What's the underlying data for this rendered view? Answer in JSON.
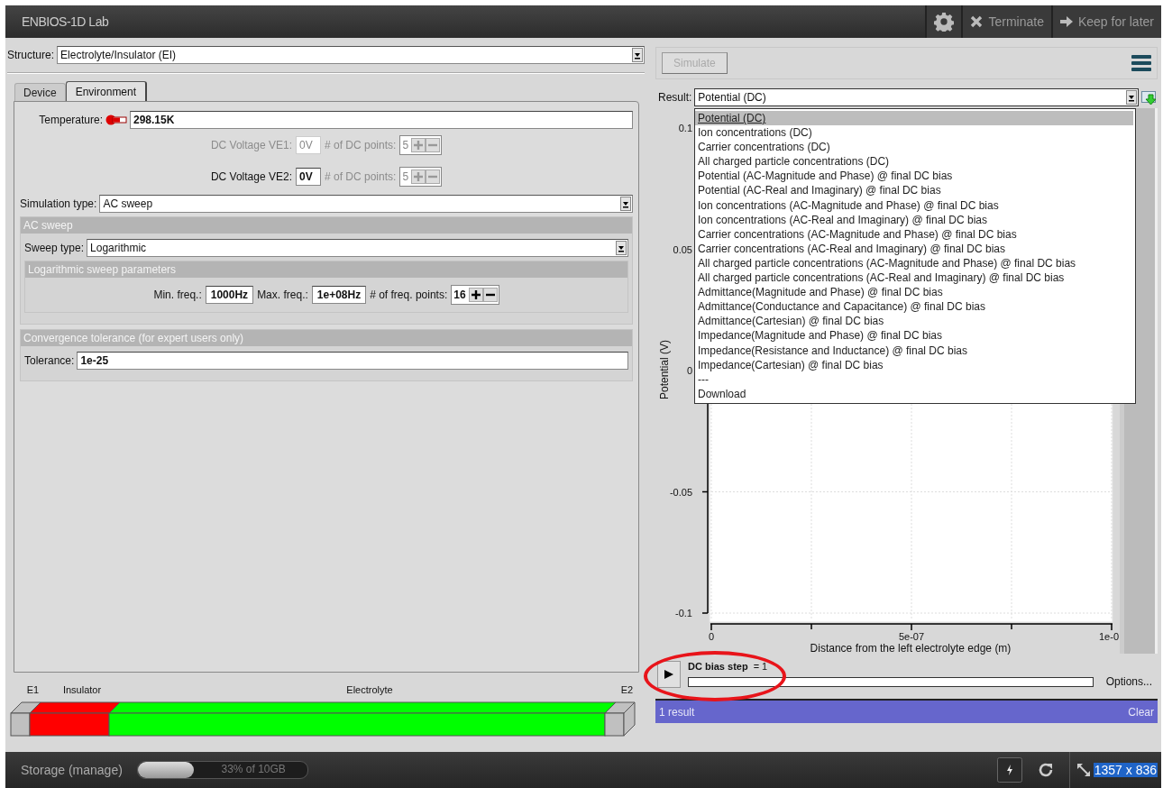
{
  "window": {
    "title": "ENBIOS-1D Lab"
  },
  "header_actions": [
    {
      "kind": "settings"
    },
    {
      "kind": "terminate",
      "label": "Terminate"
    },
    {
      "kind": "keep",
      "label": "Keep for later"
    }
  ],
  "structure": {
    "label": "Structure:",
    "value": "Electrolyte/Insulator (EI)"
  },
  "tabs": [
    {
      "label": "Device",
      "selected": false
    },
    {
      "label": "Environment",
      "selected": true
    }
  ],
  "temperature": {
    "label": "Temperature:",
    "value": "298.15K"
  },
  "dc_voltages": [
    {
      "label": "DC Voltage VE1:",
      "value": "0V",
      "disabled": true,
      "points_label": "# of DC points:",
      "points": "5",
      "points_disabled": true
    },
    {
      "label": "DC Voltage VE2:",
      "value": "0V",
      "disabled": false,
      "points_label": "# of DC points:",
      "points": "5",
      "points_disabled": true
    }
  ],
  "simulation_type": {
    "label": "Simulation type:",
    "value": "AC sweep"
  },
  "ac_sweep": {
    "title": "AC sweep",
    "sweep_type": {
      "label": "Sweep type:",
      "value": "Logarithmic"
    },
    "parameters": {
      "title": "Logarithmic sweep parameters",
      "fields": [
        {
          "label": "Min. freq.:",
          "value": "1000Hz"
        },
        {
          "label": "Max. freq.:",
          "value": "1e+08Hz"
        }
      ],
      "points": {
        "label": "# of freq. points:",
        "value": "16",
        "disabled": false
      }
    }
  },
  "convergence": {
    "title": "Convergence tolerance (for expert users only)",
    "field": {
      "label": "Tolerance:",
      "value": "1e-25"
    }
  },
  "device": {
    "layers": [
      {
        "kind": "electrode",
        "label": "E1",
        "color": "#c0c0c0"
      },
      {
        "kind": "insulator",
        "label": "Insulator",
        "color": "#ff0000"
      },
      {
        "kind": "electrolyte",
        "label": "Electrolyte",
        "color": "#00ff00"
      },
      {
        "kind": "electrode",
        "label": "E2",
        "color": "#c0c0c0"
      }
    ]
  },
  "toolbar": {
    "simulate": {
      "label": "Simulate",
      "disabled": true
    }
  },
  "result": {
    "label": "Result:",
    "value": "Potential (DC)",
    "open": true,
    "options": [
      {
        "label": "Potential (DC)",
        "selected": true
      },
      {
        "label": "Ion concentrations (DC)",
        "selected": false
      },
      {
        "label": "Carrier concentrations (DC)",
        "selected": false
      },
      {
        "label": "All charged particle concentrations (DC)",
        "selected": false
      },
      {
        "label": "Potential (AC-Magnitude and Phase) @ final DC bias",
        "selected": false
      },
      {
        "label": "Potential (AC-Real and Imaginary) @ final DC bias",
        "selected": false
      },
      {
        "label": "Ion concentrations (AC-Magnitude and Phase) @ final DC bias",
        "selected": false
      },
      {
        "label": "Ion concentrations (AC-Real and Imaginary) @ final DC bias",
        "selected": false
      },
      {
        "label": "Carrier concentrations (AC-Magnitude and Phase) @ final DC bias",
        "selected": false
      },
      {
        "label": "Carrier concentrations (AC-Real and Imaginary) @ final DC bias",
        "selected": false
      },
      {
        "label": "All charged particle concentrations (AC-Magnitude and Phase) @ final DC bias",
        "selected": false
      },
      {
        "label": "All charged particle concentrations (AC-Real and Imaginary) @ final DC bias",
        "selected": false
      },
      {
        "label": "Admittance(Magnitude and Phase) @ final DC bias",
        "selected": false
      },
      {
        "label": "Admittance(Conductance and Capacitance) @ final DC bias",
        "selected": false
      },
      {
        "label": "Admittance(Cartesian) @ final DC bias",
        "selected": false
      },
      {
        "label": "Impedance(Magnitude and Phase) @ final DC bias",
        "selected": false
      },
      {
        "label": "Impedance(Resistance and Inductance) @ final DC bias",
        "selected": false
      },
      {
        "label": "Impedance(Cartesian) @ final DC bias",
        "selected": false
      },
      {
        "label": "---",
        "selected": false
      },
      {
        "label": "Download",
        "selected": false
      }
    ]
  },
  "chart": {
    "chart_data": {
      "type": "line",
      "xlabel": "Distance from the left electrolyte edge (m)",
      "ylabel": "Potential (V)",
      "xlim": [
        0,
        1e-06
      ],
      "ylim": [
        -0.1,
        0.1
      ],
      "xticks": [
        {
          "value": 0,
          "label": "0"
        },
        {
          "value": 5e-07,
          "label": "5e-07"
        },
        {
          "label": "1e-0"
        }
      ],
      "yticks": [
        0.1,
        0.05,
        0,
        -0.05,
        -0.1
      ]
    }
  },
  "playback": {
    "label": "DC bias step",
    "value": "= 1",
    "level": 0,
    "options_label": "Options..."
  },
  "results_bar": {
    "count": "1 result",
    "clear": "Clear"
  },
  "status_bar": {
    "storage_label": "Storage (manage)",
    "storage": {
      "level": 0.33,
      "text": "33% of 10GB"
    },
    "screen_size": {
      "text": "1357 x 836",
      "highlighted": true
    }
  }
}
